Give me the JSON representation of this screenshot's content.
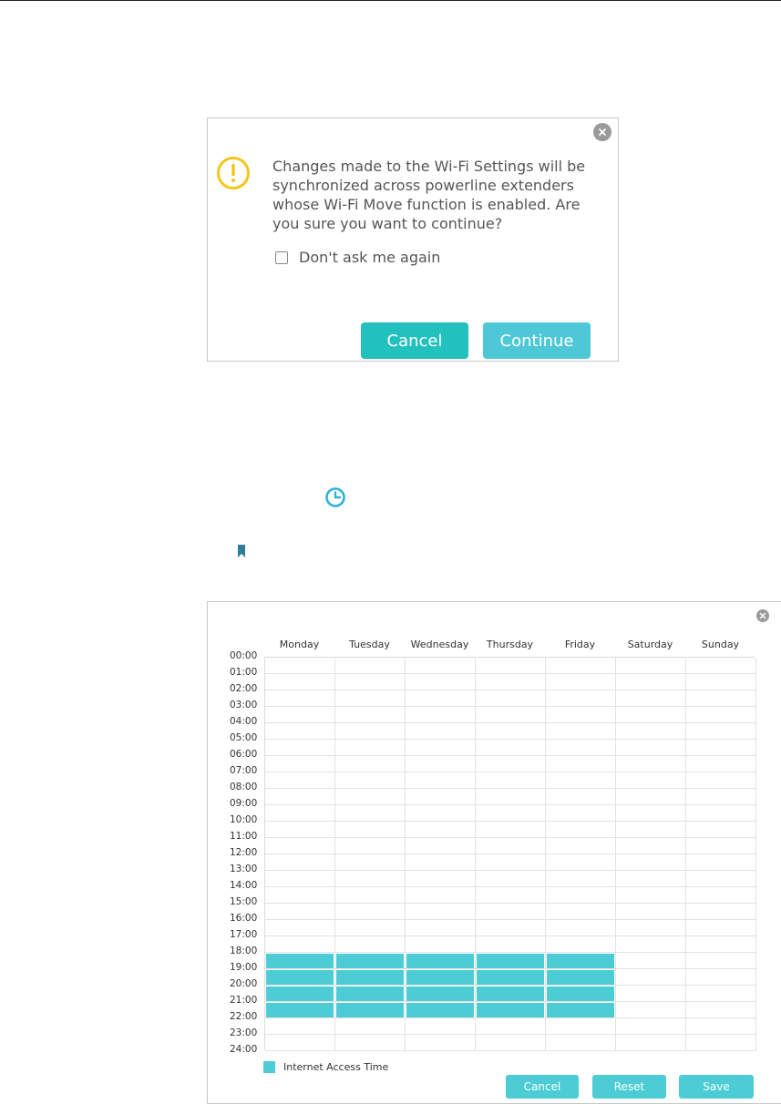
{
  "warning_dialog": {
    "message": "Changes made to the Wi-Fi Settings will be synchronized across powerline extenders whose Wi-Fi Move function is enabled. Are you sure you want to continue?",
    "checkbox_label": "Don't ask me again",
    "checkbox_checked": false,
    "cancel_label": "Cancel",
    "continue_label": "Continue",
    "icons": {
      "warning": "warning-icon",
      "close": "close-icon"
    }
  },
  "icons": {
    "clock": "clock-icon",
    "bookmark": "bookmark-icon"
  },
  "schedule_dialog": {
    "days": [
      "Monday",
      "Tuesday",
      "Wednesday",
      "Thursday",
      "Friday",
      "Saturday",
      "Sunday"
    ],
    "hours": [
      "00:00",
      "01:00",
      "02:00",
      "03:00",
      "04:00",
      "05:00",
      "06:00",
      "07:00",
      "08:00",
      "09:00",
      "10:00",
      "11:00",
      "12:00",
      "13:00",
      "14:00",
      "15:00",
      "16:00",
      "17:00",
      "18:00",
      "19:00",
      "20:00",
      "21:00",
      "22:00",
      "23:00",
      "24:00"
    ],
    "selected": {
      "days": [
        0,
        1,
        2,
        3,
        4
      ],
      "hours": [
        18,
        19,
        20,
        21
      ]
    },
    "legend_label": "Internet Access Time",
    "cancel_label": "Cancel",
    "reset_label": "Reset",
    "save_label": "Save",
    "colors": {
      "selected": "#4ccdd6"
    }
  }
}
